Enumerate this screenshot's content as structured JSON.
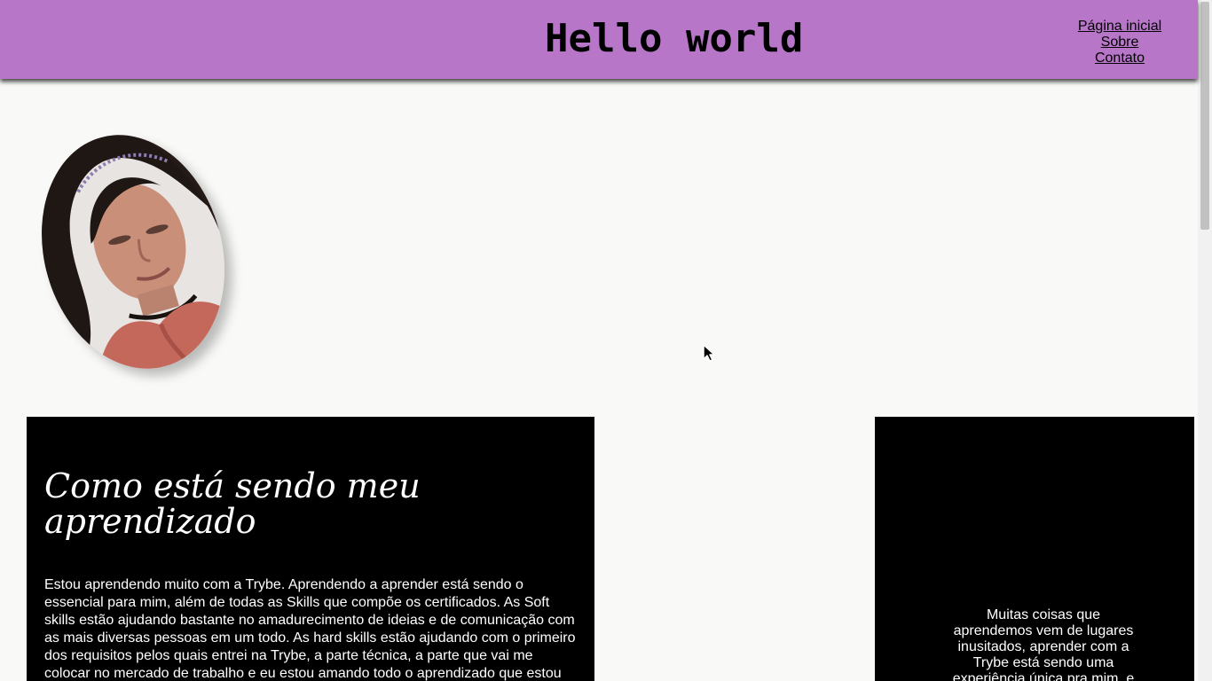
{
  "header": {
    "title": "Hello world",
    "background_color": "#b776c7",
    "nav": {
      "home": "Página inicial",
      "about": "Sobre",
      "contact": "Contato"
    }
  },
  "profile": {
    "photo_icon": "profile-photo"
  },
  "learning": {
    "title": "Como está sendo meu aprendizado",
    "text": "Estou aprendendo muito com a Trybe. Aprendendo a aprender está sendo o essencial para mim, além de todas as Skills que compõe os certificados. As Soft skills estão ajudando bastante no amadurecimento de ideias e de comunicação com as mais diversas pessoas em um todo. As hard skills estão ajudando com o primeiro dos requisitos pelos quais entrei na Trybe, a parte técnica, a parte que vai me colocar no mercado de trabalho e eu estou amando todo o aprendizado que estou"
  },
  "side": {
    "text": "Muitas coisas que aprendemos vem de lugares inusitados, aprender com a Trybe está sendo uma experiência única pra mim, e"
  },
  "colors": {
    "page_background": "#f9f9f7",
    "card_background": "#000000",
    "card_text": "#ffffff"
  }
}
